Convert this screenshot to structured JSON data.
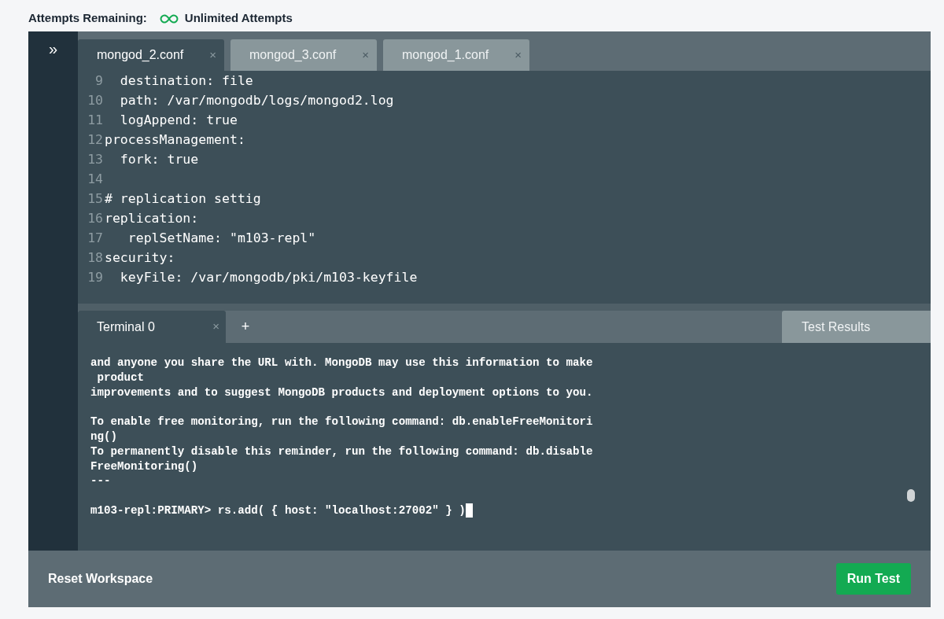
{
  "header": {
    "label": "Attempts Remaining:",
    "value": "Unlimited Attempts"
  },
  "sidebar": {
    "toggle": "»"
  },
  "editor_tabs": [
    {
      "label": "mongod_2.conf",
      "close": "×",
      "selected": true
    },
    {
      "label": "mongod_3.conf",
      "close": "×",
      "selected": false
    },
    {
      "label": "mongod_1.conf",
      "close": "×",
      "selected": false
    }
  ],
  "code_lines": [
    {
      "number": "9",
      "text": "  destination: file"
    },
    {
      "number": "10",
      "text": "  path: /var/mongodb/logs/mongod2.log"
    },
    {
      "number": "11",
      "text": "  logAppend: true"
    },
    {
      "number": "12",
      "text": "processManagement:"
    },
    {
      "number": "13",
      "text": "  fork: true"
    },
    {
      "number": "14"
    },
    {
      "number": "15",
      "text": "# replication settig"
    },
    {
      "number": "16",
      "text": "replication:"
    },
    {
      "number": "17",
      "text": "   replSetName: \"m103-repl\""
    },
    {
      "number": "18",
      "text": "security:"
    },
    {
      "number": "19",
      "text": "  keyFile: /var/mongodb/pki/m103-keyfile"
    }
  ],
  "terminal_tabs": [
    {
      "label": "Terminal 0",
      "close": "×",
      "selected": true
    }
  ],
  "add_terminal": "+",
  "test_results_tab": "Test Results",
  "terminal_blocks": [
    [
      "and anyone you share the URL with. MongoDB may use this information to make",
      " product",
      "improvements and to suggest MongoDB products and deployment options to you."
    ],
    [
      "To enable free monitoring, run the following command: db.enableFreeMonitori",
      "ng()",
      "To permanently disable this reminder, run the following command: db.disable",
      "FreeMonitoring()",
      "---"
    ]
  ],
  "prompt": "m103-repl:PRIMARY> rs.add( { host: \"localhost:27002\" } )",
  "footer": {
    "reset": "Reset Workspace",
    "run": "Run Test"
  }
}
